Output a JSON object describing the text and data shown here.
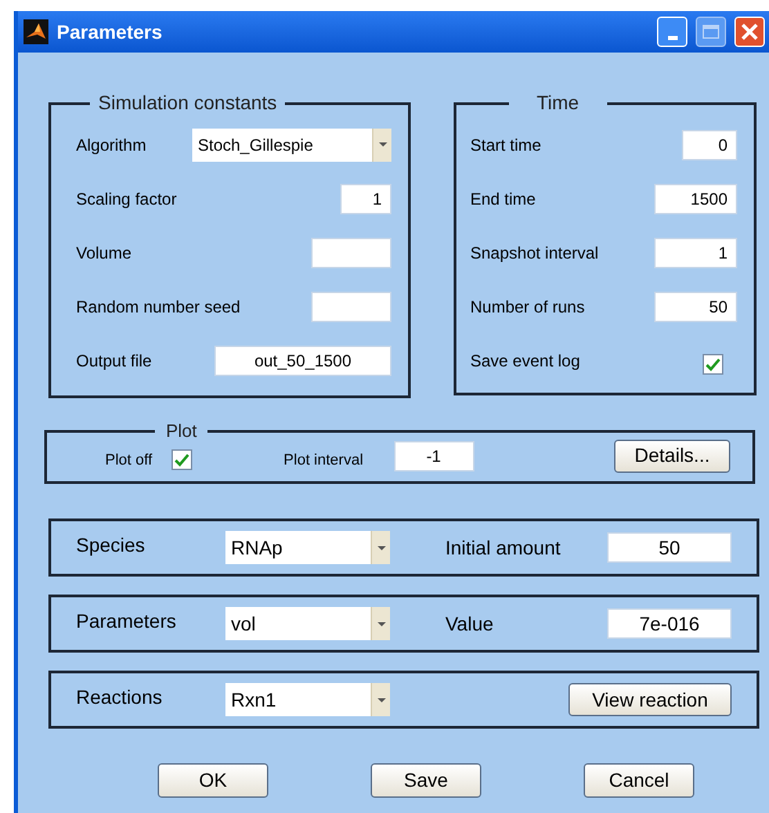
{
  "window": {
    "title": "Parameters"
  },
  "simulation_constants": {
    "title": "Simulation constants",
    "rows": [
      {
        "kind": "dropdown",
        "label": "Algorithm",
        "value": "Stoch_Gillespie"
      },
      {
        "kind": "field",
        "label": "Scaling factor",
        "value": "1"
      },
      {
        "kind": "field",
        "label": "Volume"
      },
      {
        "kind": "field",
        "label": "Random number seed"
      },
      {
        "kind": "field",
        "label": "Output file",
        "value": "out_50_1500"
      }
    ]
  },
  "time": {
    "title": "Time",
    "rows": [
      {
        "kind": "field",
        "label": "Start time",
        "value": "0"
      },
      {
        "kind": "field",
        "label": "End time",
        "value": "1500"
      },
      {
        "kind": "field",
        "label": "Snapshot interval",
        "value": "1"
      },
      {
        "kind": "field",
        "label": "Number of runs",
        "value": "50"
      },
      {
        "kind": "checkbox",
        "label": "Save event log",
        "checked": true
      }
    ]
  },
  "plot": {
    "title": "Plot",
    "plot_off": {
      "label": "Plot off",
      "checked": true
    },
    "plot_interval": {
      "label": "Plot interval",
      "value": "-1"
    },
    "details_button": "Details..."
  },
  "panels": [
    {
      "kind": "field",
      "label": "Species",
      "selected": "RNAp",
      "field_label": "Initial amount",
      "value": "50"
    },
    {
      "kind": "field",
      "label": "Parameters",
      "selected": "vol",
      "field_label": "Value",
      "value": "7e-016"
    },
    {
      "kind": "button",
      "label": "Reactions",
      "selected": "Rxn1",
      "button": "View reaction"
    }
  ],
  "buttons": [
    "OK",
    "Save",
    "Cancel"
  ]
}
